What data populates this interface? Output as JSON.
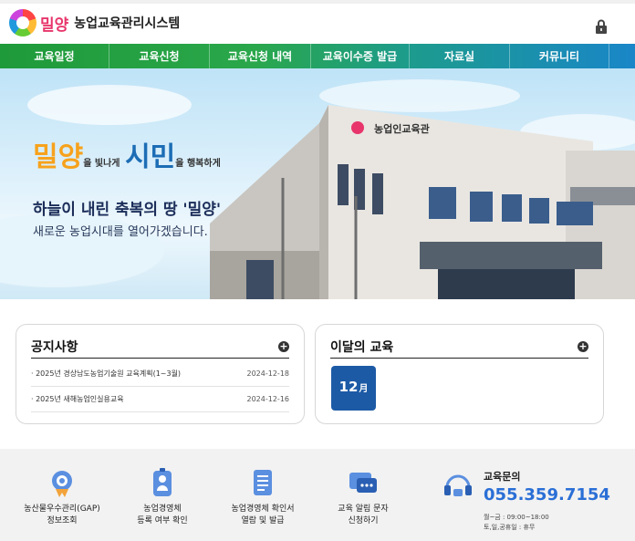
{
  "header": {
    "logo_city": "밀양",
    "logo_title": "농업교육관리시스템"
  },
  "nav": {
    "items": [
      {
        "label": "교육일정"
      },
      {
        "label": "교육신청"
      },
      {
        "label": "교육신청 내역"
      },
      {
        "label": "교육이수증 발급"
      },
      {
        "label": "자료실"
      },
      {
        "label": "커뮤니티"
      }
    ]
  },
  "hero": {
    "slogan_city": "밀양",
    "slogan_city_sub": "을 빛나게",
    "slogan_citizen": "시민",
    "slogan_citizen_sub": "을 행복하게",
    "headline": "하늘이 내린 축복의 땅 '밀양'",
    "subline": "새로운 농업시대를 열어가겠습니다.",
    "building_sign": "농업인교육관"
  },
  "notice": {
    "title": "공지사항",
    "items": [
      {
        "text": "· 2025년 경상남도농업기술원 교육계획(1~3월)",
        "date": "2024-12-18"
      },
      {
        "text": "· 2025년 새해농업인실용교육",
        "date": "2024-12-16"
      }
    ]
  },
  "monthly": {
    "title": "이달의 교육",
    "month_num": "12",
    "month_unit": "月"
  },
  "services": [
    {
      "line1": "농산물우수관리(GAP)",
      "line2": "정보조회",
      "icon": "gear-badge-icon"
    },
    {
      "line1": "농업경영체",
      "line2": "등록 여부 확인",
      "icon": "person-icon"
    },
    {
      "line1": "농업경영체 확인서",
      "line2": "열람 및 발급",
      "icon": "document-icon"
    },
    {
      "line1": "교육 알림 문자",
      "line2": "신청하기",
      "icon": "message-icon"
    }
  ],
  "contact": {
    "title": "교육문의",
    "phone": "055.359.7154",
    "hours_weekday": "월~금 : 09:00~18:00",
    "hours_weekend": "토,일,공휴일 : 휴무"
  },
  "colors": {
    "nav_green": "#1f9a3a",
    "nav_blue": "#1a86c8",
    "month_badge": "#1c5aa6",
    "phone_blue": "#2a6fd6"
  }
}
